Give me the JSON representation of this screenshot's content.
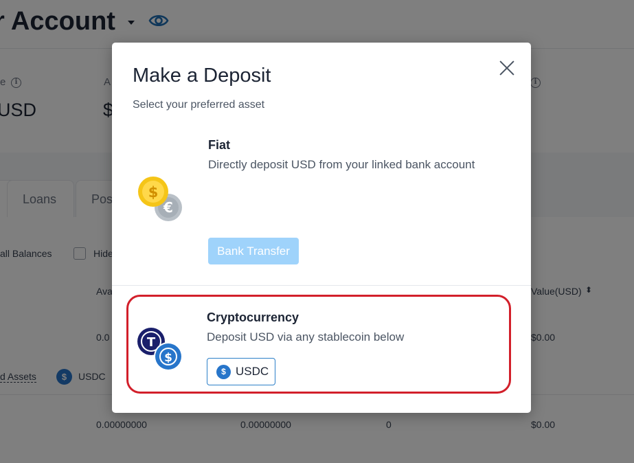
{
  "background": {
    "account_title": "r Account",
    "summary": [
      {
        "label": "e",
        "value": "USD"
      },
      {
        "label": "A",
        "value": "$"
      },
      {
        "label": "",
        "value": ""
      }
    ],
    "tabs": [
      "Loans",
      "Pos"
    ],
    "filters": {
      "all_balances": "all Balances",
      "hide": "Hide"
    },
    "table": {
      "headers": [
        "Ava",
        "Value(USD)"
      ],
      "row1": {
        "c1": "0.0",
        "value": "$0.00"
      },
      "assets_link": "d Assets",
      "usdc_chip": "USDC",
      "row2": {
        "c1": "0.00000000",
        "c2": "0.00000000",
        "c3": "0",
        "value": "$0.00"
      }
    }
  },
  "modal": {
    "title": "Make a Deposit",
    "subtitle": "Select your preferred asset",
    "close_icon": "close-icon",
    "fiat": {
      "title": "Fiat",
      "description": "Directly deposit USD from your linked bank account",
      "button": "Bank Transfer",
      "icon": "fiat-coins-icon"
    },
    "crypto": {
      "title": "Cryptocurrency",
      "description": "Deposit USD via any stablecoin below",
      "button": "USDC",
      "icon": "stablecoin-icon"
    }
  },
  "colors": {
    "highlight": "#d21f2a",
    "primary_disabled": "#9fd3fb",
    "usdc_blue": "#2775ca",
    "tusd_navy": "#1a1f6b",
    "gold": "#f5c518"
  }
}
